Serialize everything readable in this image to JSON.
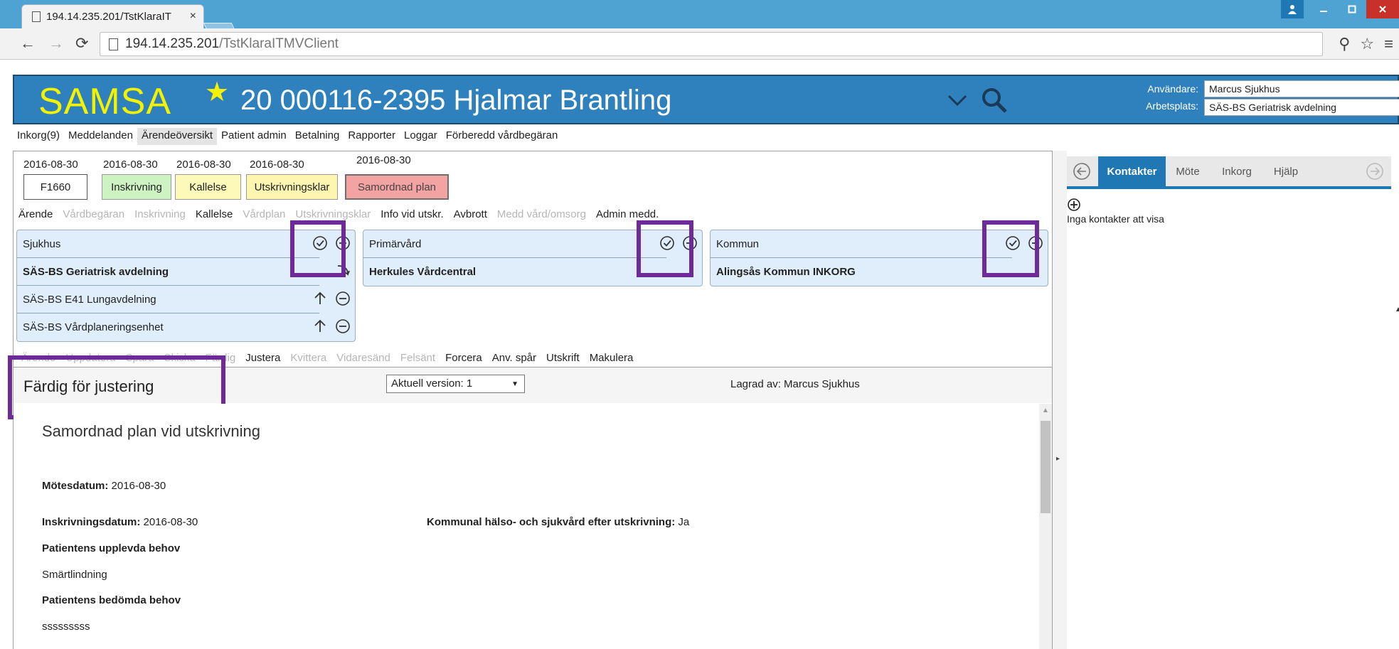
{
  "browser": {
    "tab_title": "194.14.235.201/TstKlaraIT",
    "tab_close": "×",
    "url_host": "194.14.235.201",
    "url_path": "/TstKlaraITMVClient"
  },
  "app": {
    "logo": "SAMSA",
    "patient": "20 000116-2395 Hjalmar Brantling",
    "user_label": "Användare:",
    "user_value": "Marcus Sjukhus",
    "workplace_label": "Arbetsplats:",
    "workplace_value": "SÄS-BS Geriatrisk avdelning",
    "accent": "#2f81be",
    "logo_color": "#f3f200"
  },
  "menu": [
    "Inkorg(9)",
    "Meddelanden",
    "Ärendeöversikt",
    "Patient admin",
    "Betalning",
    "Rapporter",
    "Loggar",
    "Förberedd vårdbegäran"
  ],
  "steps": {
    "dates": [
      "2016-08-30",
      "2016-08-30",
      "2016-08-30",
      "2016-08-30",
      "2016-08-30"
    ],
    "id": "F1660",
    "inskrivning": "Inskrivning",
    "kallelse": "Kallelse",
    "utskrivningsklar": "Utskrivningsklar",
    "samordnad": "Samordnad plan"
  },
  "subtabs": [
    {
      "label": "Ärende",
      "enabled": true
    },
    {
      "label": "Vårdbegäran",
      "enabled": false
    },
    {
      "label": "Inskrivning",
      "enabled": false
    },
    {
      "label": "Kallelse",
      "enabled": true
    },
    {
      "label": "Vårdplan",
      "enabled": false
    },
    {
      "label": "Utskrivningsklar",
      "enabled": false
    },
    {
      "label": "Info vid utskr.",
      "enabled": true
    },
    {
      "label": "Avbrott",
      "enabled": true
    },
    {
      "label": "Medd vård/omsorg",
      "enabled": false
    },
    {
      "label": "Admin medd.",
      "enabled": true
    }
  ],
  "care": {
    "sjukhus": {
      "title": "Sjukhus",
      "unit": "SÄS-BS Geriatrisk avdelning",
      "row2": "SÄS-BS E41 Lungavdelning",
      "row3": "SÄS-BS Vårdplaneringsenhet"
    },
    "primarvard": {
      "title": "Primärvård",
      "unit": "Herkules Vårdcentral"
    },
    "kommun": {
      "title": "Kommun",
      "unit": "Alingsås Kommun INKORG"
    }
  },
  "actions": [
    {
      "label": "Ärende",
      "enabled": false
    },
    {
      "label": "Uppdatera",
      "enabled": false
    },
    {
      "label": "Spara",
      "enabled": false
    },
    {
      "label": "Skicka",
      "enabled": false
    },
    {
      "label": "Färdig",
      "enabled": false
    },
    {
      "label": "Justera",
      "enabled": true
    },
    {
      "label": "Kvittera",
      "enabled": false
    },
    {
      "label": "Vidaresänd",
      "enabled": false
    },
    {
      "label": "Felsänt",
      "enabled": false
    },
    {
      "label": "Forcera",
      "enabled": true
    },
    {
      "label": "Anv. spår",
      "enabled": true
    },
    {
      "label": "Utskrift",
      "enabled": true
    },
    {
      "label": "Makulera",
      "enabled": true
    }
  ],
  "status": {
    "text": "Färdig för justering",
    "version": "Aktuell version: 1",
    "saved_by": "Lagrad av: Marcus Sjukhus"
  },
  "doc": {
    "title": "Samordnad plan vid utskrivning",
    "motes_label": "Mötesdatum:",
    "motes_value": "2016-08-30",
    "inskr_label": "Inskrivningsdatum:",
    "inskr_value": "2016-08-30",
    "kommunal_label": "Kommunal hälso- och sjukvård efter utskrivning:",
    "kommunal_value": "Ja",
    "upplevda_label": "Patientens upplevda behov",
    "upplevda_value": "Smärtlindning",
    "bedomda_label": "Patientens bedömda behov",
    "bedomda_value": "sssssssss"
  },
  "right": {
    "tabs": [
      "Kontakter",
      "Möte",
      "Inkorg",
      "Hjälp"
    ],
    "empty": "Inga kontakter att visa",
    "tab_color": "#1f78b4"
  }
}
